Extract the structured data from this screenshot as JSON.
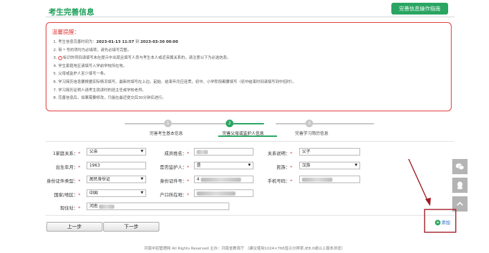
{
  "header": {
    "title": "考生完善信息",
    "guide_button": "完善信息操作指南"
  },
  "notice": {
    "title": "温馨提醒：",
    "items": [
      {
        "pre": "1. 考生信息完善时间为：",
        "start": "2023-01-13 11:57",
        "mid": " 到 ",
        "end": "2023-03-30 00:00"
      },
      {
        "text": "2. 带 * 号的项均为必填项，请先必填写完整。"
      },
      {
        "num": "3.",
        "text": "标识的项目请填写未在提示中出现且填写人员与考生本人或近亲属关系的，请注意以下为必选信息。"
      },
      {
        "text": "4. 学生家庭地区请填写入学前学校所在地。"
      },
      {
        "text": "5. 父母或监护人至少填写一条。"
      },
      {
        "text": "6. 学习简历信息要根据实际情况填写，最新的填写在上边，起始、结束年月应连贯，初中、小学阶段都要填写（初中结束时间请填写到中招时）。"
      },
      {
        "text": "7. 学习简历证明人请考生就读时的班主任或学校老师。"
      },
      {
        "text": "8. 完善信息后，如果需要修改，只能在最近提交后30分钟后进行。"
      }
    ]
  },
  "steps": [
    {
      "num": "1",
      "label": "完善考生基本信息",
      "active": false
    },
    {
      "num": "2",
      "label": "完善父母或监护人信息",
      "active": true
    },
    {
      "num": "3",
      "label": "完善学习简历信息",
      "active": false
    }
  ],
  "form": {
    "relation_label": "1家庭关系：",
    "relation_value": "父亲",
    "member_name_label": "成员姓名：",
    "relation_desc_label": "关系说明：",
    "relation_desc_value": "父子",
    "birth_label": "出生年月：",
    "birth_value": "1963",
    "guardian_label": "是否监护人：",
    "guardian_value": "是",
    "ethnicity_label": "民族：",
    "ethnicity_value": "汉族",
    "id_type_label": "身份证件类型：",
    "id_type_value": "居民身份证",
    "id_number_label": "身份证件号：",
    "id_number_value": "4",
    "phone_label": "手机号码：",
    "region_label": "国家/地区：",
    "region_value": "中国",
    "hukou_label": "户口所在地：",
    "address_label": "现住址：",
    "address_value": "河南"
  },
  "buttons": {
    "prev": "上一步",
    "next": "下一步",
    "add": "添加"
  },
  "footer": "河南中招管理网 All Rights Reserved 主办：河南省教育厅 （建议使用1024×768显示分辨率,IE8.0或以上版本浏览）",
  "colors": {
    "brand_green": "#2aa562",
    "notice_red": "#e23a3a",
    "annotation_red": "#9e1a22"
  }
}
